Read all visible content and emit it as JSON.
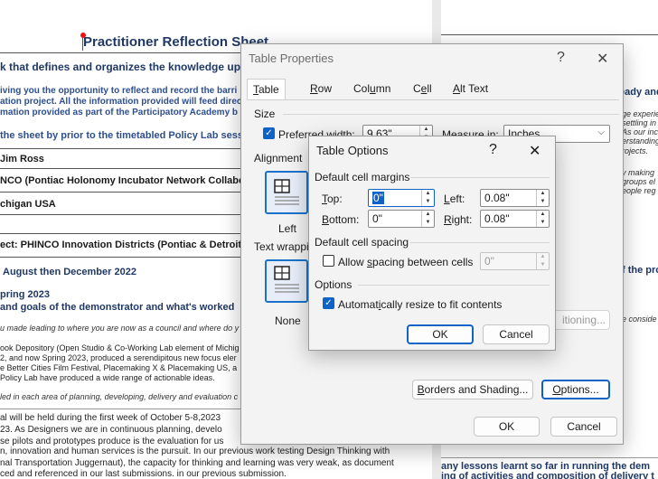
{
  "document": {
    "title": "Practitioner Reflection Sheet",
    "lines": [
      "k that defines and organizes the knowledge upon w",
      "iving you the opportunity to reflect and record the barri",
      "ation project. All the information provided will feed direc",
      "mation provided as part of the Participatory Academy b",
      "the sheet by prior to the timetabled Policy Lab session",
      "Jim Ross",
      "NCO (Pontiac Holonomy Incubator Network Collabo",
      "chigan USA",
      "ect: PHINCO Innovation Districts (Pontiac & Detroit)",
      "August then December 2022",
      "pring 2023",
      "and goals of the demonstrator and what's worked",
      "u made leading to where you are now as a council and where do y",
      "ook Depository (Open Studio & Co-Working Lab element of Michig",
      "2, and now Spring 2023, produced a serendipitous new focus eler",
      "e Better Cities Film Festival, Placemaking X & Placemaking US, a",
      "Policy Lab have produced a wide range of actionable ideas.",
      "led in each area of planning, developing, delivery and evaluation c",
      "al will be held during the first week of October 5-8,2023",
      "23. As Designers we are in continuous planning, develo",
      "se pilots and prototypes produce is the evaluation for us",
      "n, innovation and human services is the pursuit.  In our previous work testing Design Thinking with",
      "nal Transportation Juggernaut), the capacity for thinking and learning was very weak, as document",
      "ced and referenced in our last submissions.  in our previous submission."
    ],
    "right_lines": [
      "eady and",
      "ge experie",
      "settling in",
      "As our inc",
      "erstanding",
      "rojects.",
      "y making",
      "groups el",
      "eople reg",
      "f the proc",
      "e conside",
      "any lessons learnt so far in running the dem",
      "ing of activities and composition of delivery t"
    ]
  },
  "table_properties": {
    "title": "Table Properties",
    "help": "?",
    "close": "✕",
    "tabs": [
      "Table",
      "Row",
      "Column",
      "Cell",
      "Alt Text"
    ],
    "size_label": "Size",
    "preferred_width_label": "Preferred width:",
    "preferred_width_value": "9.63\"",
    "preferred_width_checked": true,
    "measure_in_label": "Measure in:",
    "measure_in_value": "Inches",
    "alignment_label": "Alignment",
    "alignment_selected": "Left",
    "text_wrapping_label": "Text wrappi",
    "wrapping_selected": "None",
    "positioning_button": "itioning...",
    "borders_button": "Borders and Shading...",
    "options_button": "Options...",
    "ok_button": "OK",
    "cancel_button": "Cancel"
  },
  "table_options": {
    "title": "Table Options",
    "help": "?",
    "close": "✕",
    "cell_margins_label": "Default cell margins",
    "top_label": "Top:",
    "top_value": "0\"",
    "left_label": "Left:",
    "left_value": "0.08\"",
    "bottom_label": "Bottom:",
    "bottom_value": "0\"",
    "right_label": "Right:",
    "right_value": "0.08\"",
    "cell_spacing_label": "Default cell spacing",
    "allow_spacing_label": "Allow spacing between cells",
    "allow_spacing_checked": false,
    "spacing_value": "0\"",
    "options_label": "Options",
    "auto_resize_label": "Automatically resize to fit contents",
    "auto_resize_checked": true,
    "ok_button": "OK",
    "cancel_button": "Cancel"
  },
  "colors": {
    "accent": "#0f63c7",
    "heading": "#1f3864",
    "dialog_bg": "#f3f3f3"
  }
}
